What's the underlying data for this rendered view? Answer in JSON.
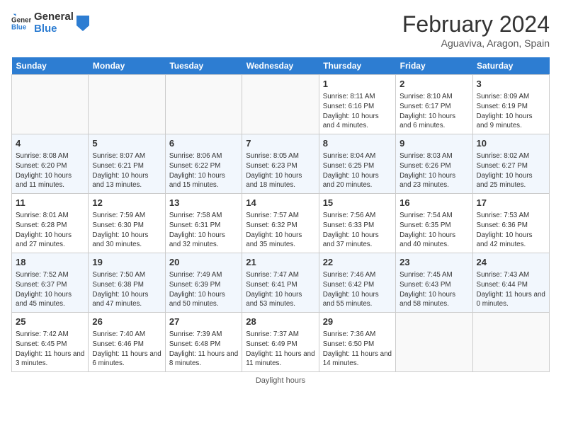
{
  "header": {
    "logo_line1": "General",
    "logo_line2": "Blue",
    "title": "February 2024",
    "subtitle": "Aguaviva, Aragon, Spain"
  },
  "days_of_week": [
    "Sunday",
    "Monday",
    "Tuesday",
    "Wednesday",
    "Thursday",
    "Friday",
    "Saturday"
  ],
  "weeks": [
    [
      {
        "day": "",
        "info": ""
      },
      {
        "day": "",
        "info": ""
      },
      {
        "day": "",
        "info": ""
      },
      {
        "day": "",
        "info": ""
      },
      {
        "day": "1",
        "info": "Sunrise: 8:11 AM\nSunset: 6:16 PM\nDaylight: 10 hours and 4 minutes."
      },
      {
        "day": "2",
        "info": "Sunrise: 8:10 AM\nSunset: 6:17 PM\nDaylight: 10 hours and 6 minutes."
      },
      {
        "day": "3",
        "info": "Sunrise: 8:09 AM\nSunset: 6:19 PM\nDaylight: 10 hours and 9 minutes."
      }
    ],
    [
      {
        "day": "4",
        "info": "Sunrise: 8:08 AM\nSunset: 6:20 PM\nDaylight: 10 hours and 11 minutes."
      },
      {
        "day": "5",
        "info": "Sunrise: 8:07 AM\nSunset: 6:21 PM\nDaylight: 10 hours and 13 minutes."
      },
      {
        "day": "6",
        "info": "Sunrise: 8:06 AM\nSunset: 6:22 PM\nDaylight: 10 hours and 15 minutes."
      },
      {
        "day": "7",
        "info": "Sunrise: 8:05 AM\nSunset: 6:23 PM\nDaylight: 10 hours and 18 minutes."
      },
      {
        "day": "8",
        "info": "Sunrise: 8:04 AM\nSunset: 6:25 PM\nDaylight: 10 hours and 20 minutes."
      },
      {
        "day": "9",
        "info": "Sunrise: 8:03 AM\nSunset: 6:26 PM\nDaylight: 10 hours and 23 minutes."
      },
      {
        "day": "10",
        "info": "Sunrise: 8:02 AM\nSunset: 6:27 PM\nDaylight: 10 hours and 25 minutes."
      }
    ],
    [
      {
        "day": "11",
        "info": "Sunrise: 8:01 AM\nSunset: 6:28 PM\nDaylight: 10 hours and 27 minutes."
      },
      {
        "day": "12",
        "info": "Sunrise: 7:59 AM\nSunset: 6:30 PM\nDaylight: 10 hours and 30 minutes."
      },
      {
        "day": "13",
        "info": "Sunrise: 7:58 AM\nSunset: 6:31 PM\nDaylight: 10 hours and 32 minutes."
      },
      {
        "day": "14",
        "info": "Sunrise: 7:57 AM\nSunset: 6:32 PM\nDaylight: 10 hours and 35 minutes."
      },
      {
        "day": "15",
        "info": "Sunrise: 7:56 AM\nSunset: 6:33 PM\nDaylight: 10 hours and 37 minutes."
      },
      {
        "day": "16",
        "info": "Sunrise: 7:54 AM\nSunset: 6:35 PM\nDaylight: 10 hours and 40 minutes."
      },
      {
        "day": "17",
        "info": "Sunrise: 7:53 AM\nSunset: 6:36 PM\nDaylight: 10 hours and 42 minutes."
      }
    ],
    [
      {
        "day": "18",
        "info": "Sunrise: 7:52 AM\nSunset: 6:37 PM\nDaylight: 10 hours and 45 minutes."
      },
      {
        "day": "19",
        "info": "Sunrise: 7:50 AM\nSunset: 6:38 PM\nDaylight: 10 hours and 47 minutes."
      },
      {
        "day": "20",
        "info": "Sunrise: 7:49 AM\nSunset: 6:39 PM\nDaylight: 10 hours and 50 minutes."
      },
      {
        "day": "21",
        "info": "Sunrise: 7:47 AM\nSunset: 6:41 PM\nDaylight: 10 hours and 53 minutes."
      },
      {
        "day": "22",
        "info": "Sunrise: 7:46 AM\nSunset: 6:42 PM\nDaylight: 10 hours and 55 minutes."
      },
      {
        "day": "23",
        "info": "Sunrise: 7:45 AM\nSunset: 6:43 PM\nDaylight: 10 hours and 58 minutes."
      },
      {
        "day": "24",
        "info": "Sunrise: 7:43 AM\nSunset: 6:44 PM\nDaylight: 11 hours and 0 minutes."
      }
    ],
    [
      {
        "day": "25",
        "info": "Sunrise: 7:42 AM\nSunset: 6:45 PM\nDaylight: 11 hours and 3 minutes."
      },
      {
        "day": "26",
        "info": "Sunrise: 7:40 AM\nSunset: 6:46 PM\nDaylight: 11 hours and 6 minutes."
      },
      {
        "day": "27",
        "info": "Sunrise: 7:39 AM\nSunset: 6:48 PM\nDaylight: 11 hours and 8 minutes."
      },
      {
        "day": "28",
        "info": "Sunrise: 7:37 AM\nSunset: 6:49 PM\nDaylight: 11 hours and 11 minutes."
      },
      {
        "day": "29",
        "info": "Sunrise: 7:36 AM\nSunset: 6:50 PM\nDaylight: 11 hours and 14 minutes."
      },
      {
        "day": "",
        "info": ""
      },
      {
        "day": "",
        "info": ""
      }
    ]
  ],
  "footer": "Daylight hours"
}
